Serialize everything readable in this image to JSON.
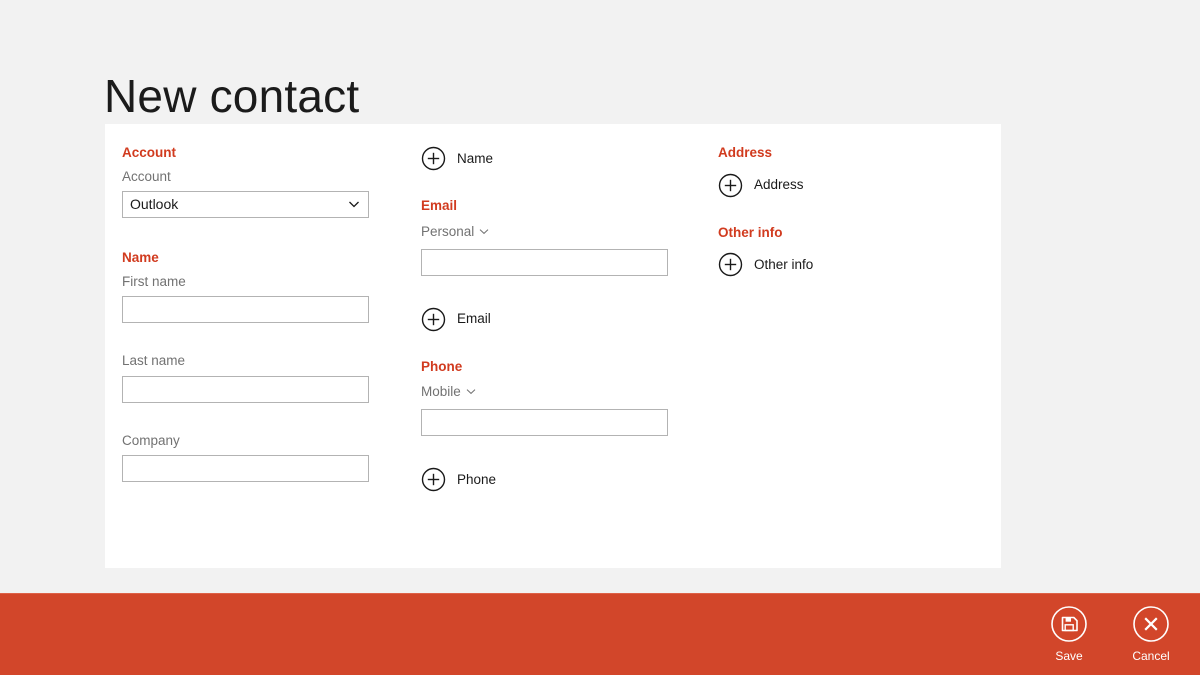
{
  "page": {
    "title": "New contact",
    "background_color": "#f2f2f2",
    "card_color": "#ffffff",
    "accent_color": "#d13b1f"
  },
  "columns": {
    "left": {
      "account_section": {
        "heading": "Account",
        "account_label": "Account",
        "account_value": "Outlook",
        "account_options": [
          "Outlook"
        ]
      },
      "name_section": {
        "heading": "Name",
        "first_name_label": "First name",
        "first_name_value": "",
        "first_name_placeholder": "",
        "last_name_label": "Last name",
        "last_name_value": "",
        "last_name_placeholder": "",
        "company_label": "Company",
        "company_value": "",
        "company_placeholder": ""
      }
    },
    "middle": {
      "add_name": "Name",
      "email_section": {
        "heading": "Email",
        "type_value": "Personal",
        "email_value": "",
        "email_placeholder": "",
        "add_email": "Email"
      },
      "phone_section": {
        "heading": "Phone",
        "type_value": "Mobile",
        "phone_value": "",
        "phone_placeholder": "",
        "add_phone": "Phone"
      }
    },
    "right": {
      "address_section": {
        "heading": "Address",
        "add_address": "Address"
      },
      "other_section": {
        "heading": "Other info",
        "add_other": "Other info"
      }
    }
  },
  "appbar": {
    "background_color": "#d2462a",
    "save_label": "Save",
    "save_icon": "save-floppy-icon",
    "cancel_label": "Cancel",
    "cancel_icon": "close-x-icon"
  }
}
